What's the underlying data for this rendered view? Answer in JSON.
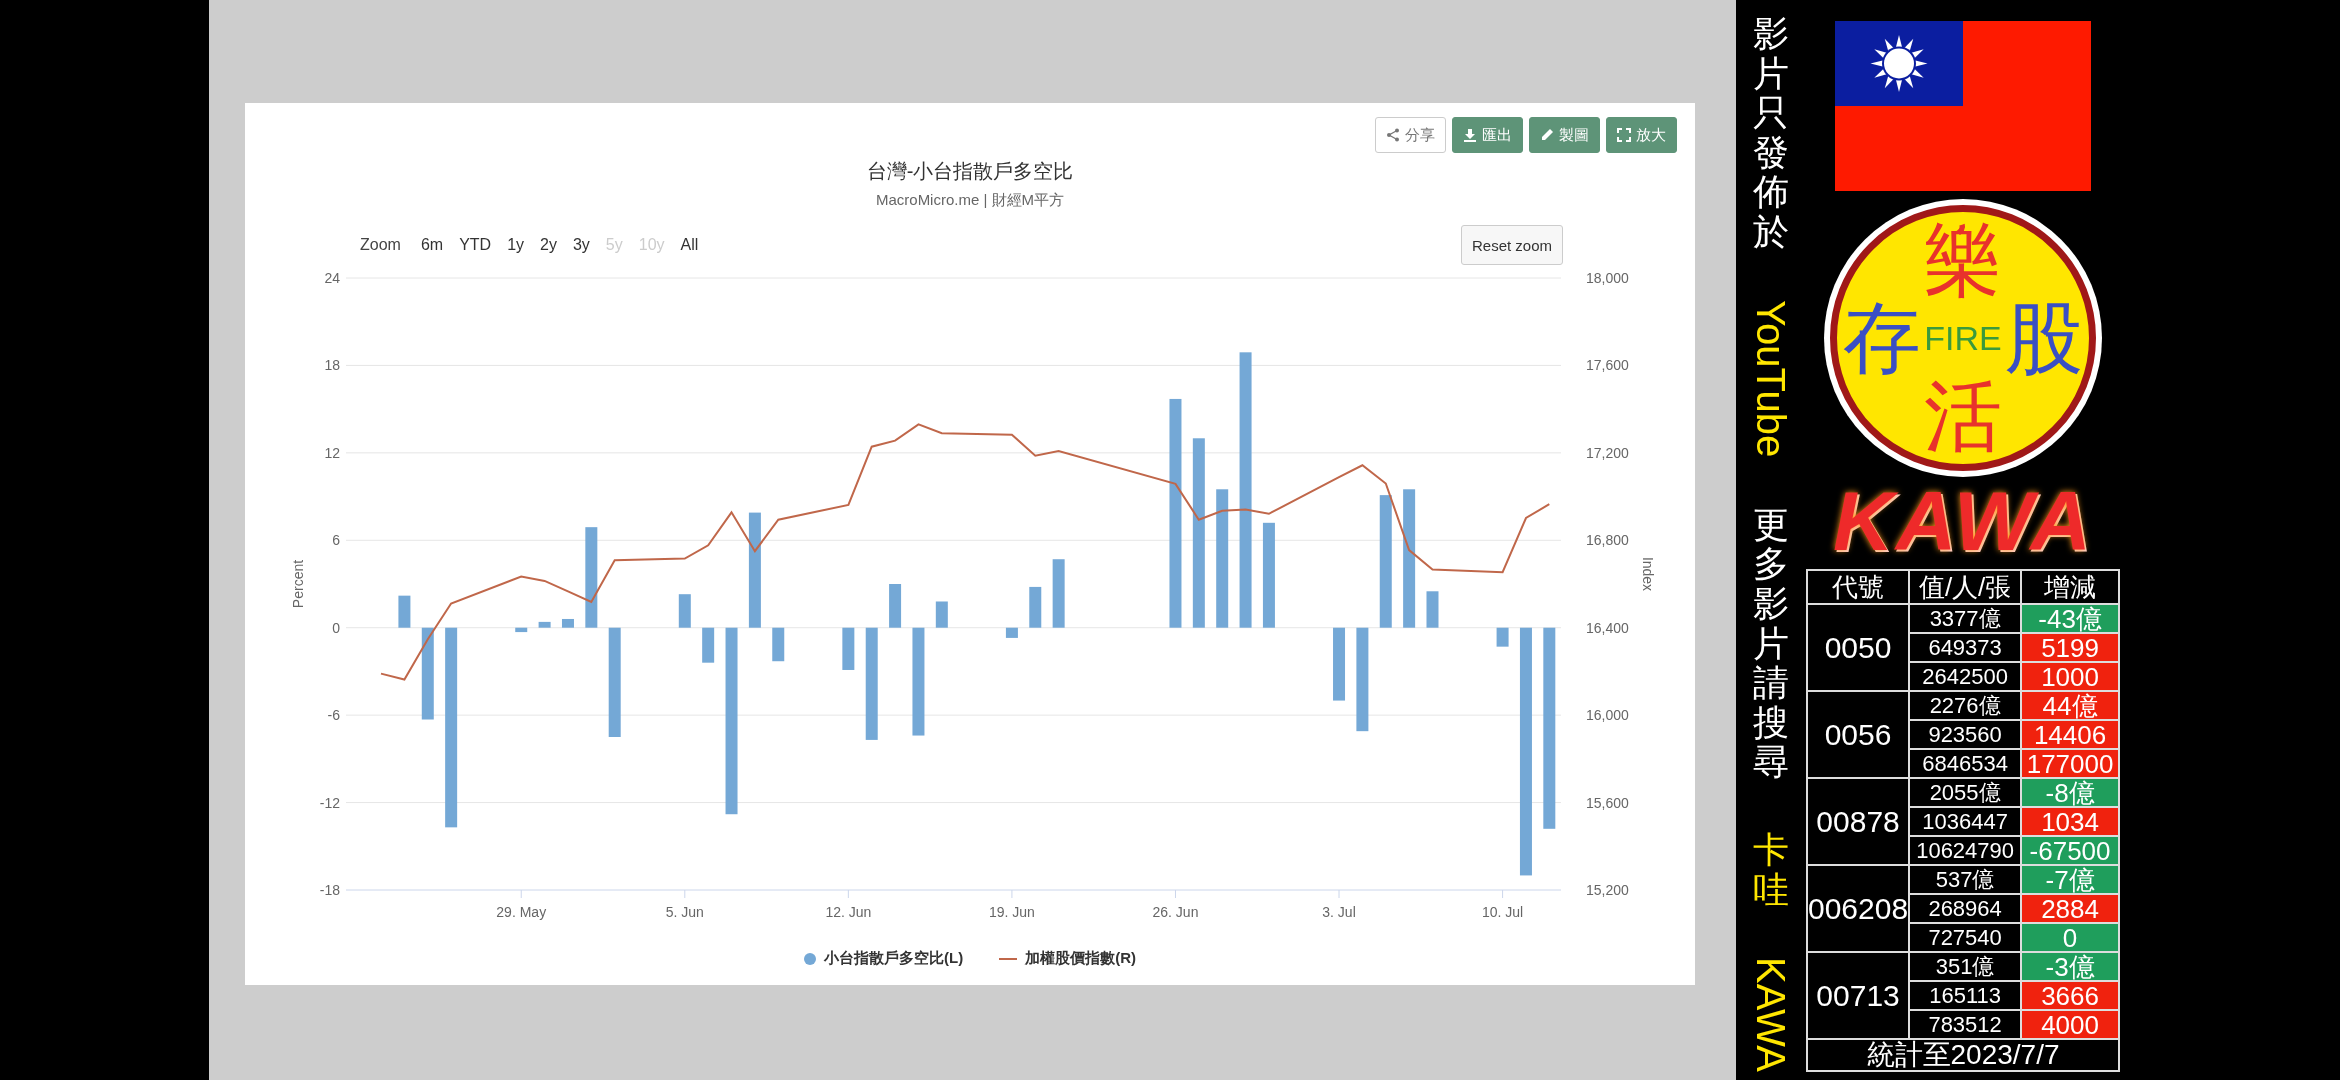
{
  "chart_panel": {
    "toolbar": [
      {
        "label": "分享",
        "kind": "outline"
      },
      {
        "label": "匯出",
        "kind": "filled"
      },
      {
        "label": "製圖",
        "kind": "filled"
      },
      {
        "label": "放大",
        "kind": "filled"
      }
    ],
    "title": "台灣-小台指散戶多空比",
    "subtitle": "MacroMicro.me | 財經M平方",
    "range_label": "Zoom",
    "ranges": [
      {
        "label": "6m",
        "disabled": false
      },
      {
        "label": "YTD",
        "disabled": false
      },
      {
        "label": "1y",
        "disabled": false
      },
      {
        "label": "2y",
        "disabled": false
      },
      {
        "label": "3y",
        "disabled": false
      },
      {
        "label": "5y",
        "disabled": true
      },
      {
        "label": "10y",
        "disabled": true
      },
      {
        "label": "All",
        "disabled": false
      }
    ],
    "reset_zoom": "Reset zoom",
    "chart_data": {
      "type": "bar",
      "grid": true,
      "ylabel": "Percent",
      "y2label": "Index",
      "categories": [
        null,
        null,
        null,
        null,
        null,
        null,
        null,
        "29. May",
        null,
        null,
        null,
        null,
        null,
        null,
        "5. Jun",
        null,
        null,
        null,
        null,
        null,
        null,
        "12. Jun",
        null,
        null,
        null,
        null,
        null,
        null,
        "19. Jun",
        null,
        null,
        null,
        null,
        null,
        null,
        "26. Jun",
        null,
        null,
        null,
        null,
        null,
        null,
        "3. Jul",
        null,
        null,
        null,
        null,
        null,
        null,
        "10. Jul",
        null,
        null
      ],
      "ylim": [
        -18,
        24
      ],
      "yticks": [
        -18,
        -12,
        -6,
        0,
        6,
        12,
        18,
        24
      ],
      "y2lim": [
        15200,
        18000
      ],
      "y2ticks": [
        {
          "value": 15200,
          "label": "15,200"
        },
        {
          "value": 15600,
          "label": "15,600"
        },
        {
          "value": 16000,
          "label": "16,000"
        },
        {
          "value": 16400,
          "label": "16,400"
        },
        {
          "value": 16800,
          "label": "16,800"
        },
        {
          "value": 17200,
          "label": "17,200"
        },
        {
          "value": 17600,
          "label": "17,600"
        },
        {
          "value": 18000,
          "label": "18,000"
        }
      ],
      "series": [
        {
          "name": "小台指散戶多空比(L)",
          "color": "#74a8d6",
          "values": [
            null,
            null,
            2.2,
            -6.3,
            -13.7,
            null,
            null,
            -0.3,
            0.4,
            0.6,
            6.9,
            -7.5,
            null,
            null,
            2.3,
            -2.4,
            -12.8,
            7.9,
            -2.3,
            null,
            null,
            -2.9,
            -7.7,
            3.0,
            -7.4,
            1.8,
            null,
            null,
            -0.7,
            2.8,
            4.7,
            null,
            null,
            null,
            null,
            15.7,
            13.0,
            9.5,
            18.9,
            7.2,
            null,
            null,
            -5.0,
            -7.1,
            9.1,
            9.5,
            2.5,
            null,
            null,
            -1.3,
            -17.0,
            -13.8
          ]
        },
        {
          "name": "加權股價指數(R)",
          "type": "line",
          "axis": "y2",
          "color": "#c0674a",
          "values": [
            null,
            16190,
            16163,
            16347,
            16511,
            null,
            null,
            16634,
            16614,
            16566,
            16518,
            16709,
            null,
            null,
            16716,
            16777,
            16928,
            16750,
            16894,
            null,
            null,
            16962,
            17228,
            17256,
            17330,
            17290,
            null,
            null,
            17283,
            17187,
            17208,
            null,
            null,
            null,
            null,
            17058,
            16894,
            16935,
            16941,
            16921,
            null,
            null,
            17089,
            17143,
            17060,
            16755,
            16666,
            null,
            null,
            16654,
            16902,
            16965
          ]
        }
      ]
    }
  },
  "side_caption": [
    {
      "text": "影片只發佈於",
      "sideways": false,
      "highlighted": false
    },
    {
      "text": "YouTube",
      "sideways": true,
      "highlighted": true
    },
    {
      "text": "更多影片請搜尋",
      "sideways": false,
      "highlighted": false
    },
    {
      "text": "卡哇",
      "sideways": false,
      "highlighted": true
    },
    {
      "text": "KAWA",
      "sideways": true,
      "highlighted": true
    }
  ],
  "logo": {
    "top": "樂",
    "left": "存",
    "center": "FIRE",
    "right": "股",
    "bottom": "活"
  },
  "brand": "KAWA",
  "etf_table": {
    "columns": [
      "代號",
      "值/人/張",
      "增減"
    ],
    "groups": [
      {
        "code": "0050",
        "rows": [
          {
            "value": "3377億",
            "change": "-43億",
            "color": "#1f9e5c"
          },
          {
            "value": "649373",
            "change": "5199",
            "color": "#f0220e"
          },
          {
            "value": "2642500",
            "change": "1000",
            "color": "#f0220e"
          }
        ]
      },
      {
        "code": "0056",
        "rows": [
          {
            "value": "2276億",
            "change": "44億",
            "color": "#f0220e"
          },
          {
            "value": "923560",
            "change": "14406",
            "color": "#f0220e"
          },
          {
            "value": "6846534",
            "change": "177000",
            "color": "#f0220e"
          }
        ]
      },
      {
        "code": "00878",
        "rows": [
          {
            "value": "2055億",
            "change": "-8億",
            "color": "#1f9e5c"
          },
          {
            "value": "1036447",
            "change": "1034",
            "color": "#f0220e"
          },
          {
            "value": "10624790",
            "change": "-67500",
            "color": "#1f9e5c"
          }
        ]
      },
      {
        "code": "006208",
        "rows": [
          {
            "value": "537億",
            "change": "-7億",
            "color": "#1f9e5c"
          },
          {
            "value": "268964",
            "change": "2884",
            "color": "#f0220e"
          },
          {
            "value": "727540",
            "change": "0",
            "color": "#1f9e5c"
          }
        ]
      },
      {
        "code": "00713",
        "rows": [
          {
            "value": "351億",
            "change": "-3億",
            "color": "#1f9e5c"
          },
          {
            "value": "165113",
            "change": "3666",
            "color": "#f0220e"
          },
          {
            "value": "783512",
            "change": "4000",
            "color": "#f0220e"
          }
        ]
      }
    ],
    "footer": "統計至2023/7/7"
  }
}
